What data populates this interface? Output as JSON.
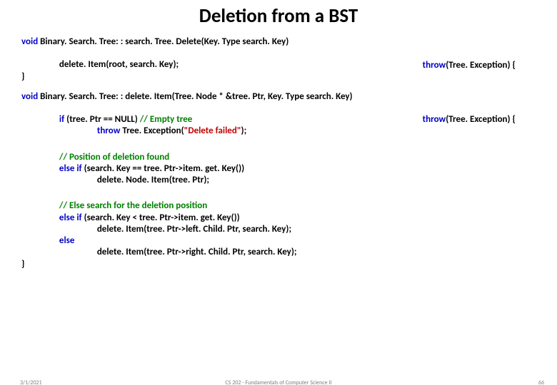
{
  "title": "Deletion from a BST",
  "block1": {
    "sig_kw": "void ",
    "sig_rest": "Binary. Search. Tree: : search. Tree. Delete(Key. Type search. Key)",
    "throw_kw": "throw",
    "throw_rest": "(Tree. Exception) {",
    "body": "delete. Item(root, search. Key);",
    "close": "}"
  },
  "block2": {
    "sig_kw": "void ",
    "sig_rest": "Binary. Search. Tree: : delete. Item(Tree. Node * &tree. Ptr, Key. Type search. Key)",
    "throw_kw": "throw",
    "throw_rest": "(Tree. Exception) {",
    "if_kw": "if ",
    "if_cond": "(tree. Ptr == NULL) ",
    "if_comment": "// Empty tree",
    "throw_stmt_kw": "throw",
    "throw_stmt_rest": " Tree. Exception(",
    "throw_str": "\"Delete failed\"",
    "throw_stmt_end": ");",
    "c2": "// Position of deletion found",
    "elif1_kw": "else if ",
    "elif1_rest": "(search. Key == tree. Ptr->item. get. Key())",
    "elif1_body": "delete. Node. Item(tree. Ptr);",
    "c3": "// Else search for the deletion position",
    "elif2_kw": "else if ",
    "elif2_rest": "(search. Key < tree. Ptr->item. get. Key())",
    "elif2_body": "delete. Item(tree. Ptr->left. Child. Ptr, search. Key);",
    "else_kw": "else",
    "else_body": "delete. Item(tree. Ptr->right. Child. Ptr, search. Key);",
    "close": "}"
  },
  "footer": {
    "date": "3/1/2021",
    "center": "CS 202 - Fundamentals of Computer Science II",
    "page": "66"
  }
}
